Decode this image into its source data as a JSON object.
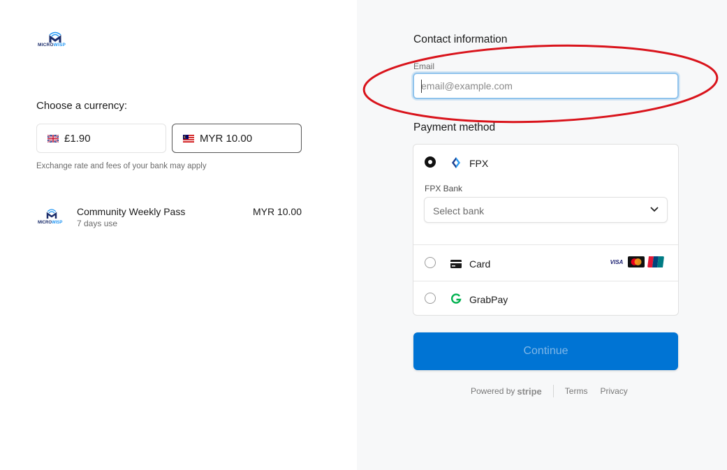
{
  "left": {
    "logo": {
      "text_a": "MICRO",
      "text_b": "WISP"
    },
    "choose_currency_label": "Choose a currency:",
    "currency_options": [
      {
        "label": "£1.90",
        "selected": false
      },
      {
        "label": "MYR 10.00",
        "selected": true
      }
    ],
    "exchange_note": "Exchange rate and fees of your bank may apply",
    "line_item": {
      "name": "Community Weekly Pass",
      "description": "7 days use",
      "price": "MYR 10.00"
    }
  },
  "right": {
    "contact_title": "Contact information",
    "email_label": "Email",
    "email_placeholder": "email@example.com",
    "email_value": "",
    "payment_title": "Payment method",
    "payment_methods": [
      {
        "label": "FPX",
        "selected": true,
        "bank_label": "FPX Bank",
        "bank_placeholder": "Select bank"
      },
      {
        "label": "Card",
        "selected": false,
        "brands": [
          "VISA",
          "mastercard",
          "UnionPay"
        ]
      },
      {
        "label": "GrabPay",
        "selected": false
      }
    ],
    "continue_label": "Continue"
  },
  "footer": {
    "powered_by": "Powered by",
    "stripe": "stripe",
    "terms": "Terms",
    "privacy": "Privacy"
  },
  "colors": {
    "accent": "#0074d4",
    "annotation": "#d9141c",
    "focus_ring": "#8fc3ec"
  }
}
